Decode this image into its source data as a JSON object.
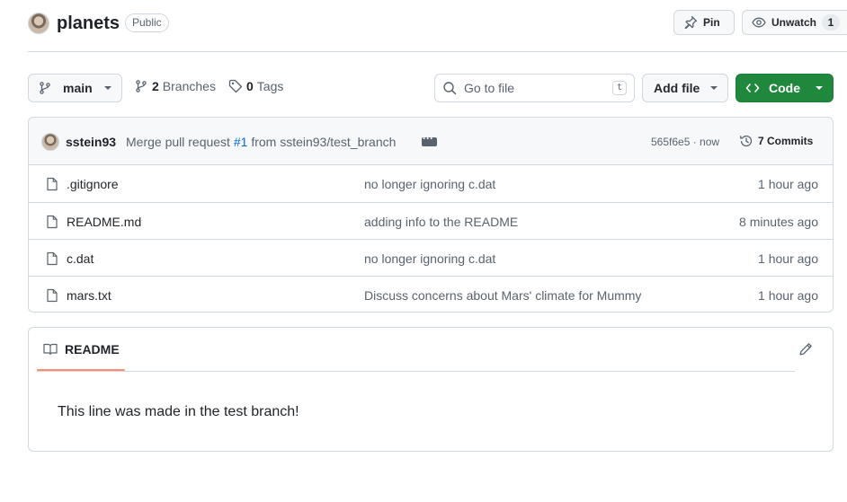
{
  "repo": {
    "name": "planets",
    "visibility": "Public"
  },
  "header_actions": {
    "pin_label": "Pin",
    "watch_label": "Unwatch",
    "watch_count": "1"
  },
  "toolbar": {
    "branch": "main",
    "branches_count": "2",
    "branches_label": "Branches",
    "tags_count": "0",
    "tags_label": "Tags",
    "search_placeholder": "Go to file",
    "search_shortcut": "t",
    "add_file_label": "Add file",
    "code_label": "Code"
  },
  "latest_commit": {
    "author": "sstein93",
    "message_prefix": "Merge pull request",
    "pr_link": "#1",
    "message_suffix": "from sstein93/test_branch",
    "sha_time": "565f6e5 · now",
    "commits_label": "7 Commits"
  },
  "files": [
    {
      "name": ".gitignore",
      "message": "no longer ignoring c.dat",
      "age": "1 hour ago"
    },
    {
      "name": "README.md",
      "message": "adding info to the README",
      "age": "8 minutes ago"
    },
    {
      "name": "c.dat",
      "message": "no longer ignoring c.dat",
      "age": "1 hour ago"
    },
    {
      "name": "mars.txt",
      "message": "Discuss concerns about Mars' climate for Mummy",
      "age": "1 hour ago"
    }
  ],
  "readme": {
    "tab_label": "README",
    "body": "This line was made in the test branch!"
  },
  "colors": {
    "code_button": "#1f883d",
    "link": "#0969da",
    "tab_underline": "#fd8c73"
  },
  "icons": {
    "pin": "pin-icon",
    "eye": "eye-icon",
    "branch": "git-branch-icon",
    "tag": "tag-icon",
    "search": "search-icon",
    "code": "code-icon",
    "history": "history-icon",
    "file": "file-icon",
    "book": "book-icon",
    "pencil": "pencil-icon"
  }
}
